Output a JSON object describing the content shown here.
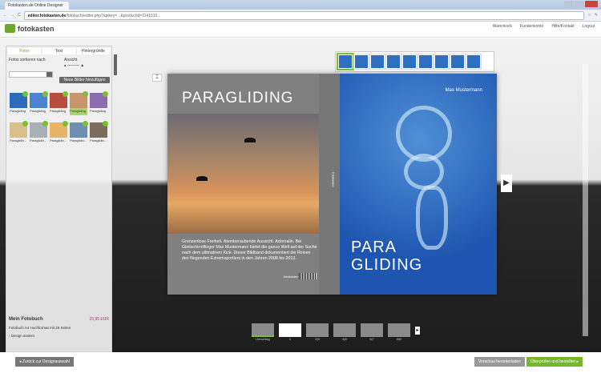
{
  "browser": {
    "tab_title": "Fotokasten.de Online Designer",
    "url_host": "editor.fotokasten.de",
    "url_rest": "/fotobuch/editor.php?apikey=...&productid=1141510...",
    "window_label": "Fotokasten"
  },
  "header": {
    "logo": "fotokasten",
    "links": [
      "Warenkorb",
      "Kundenkonto",
      "Hilfe/Kontakt",
      "Logout"
    ]
  },
  "left_panel": {
    "tabs": [
      "Fotos",
      "Text",
      "Hintergründe"
    ],
    "sort_label": "Fotos sortieren nach",
    "view_label": "Ansicht",
    "add_button": "Neue Bilder hinzufügen",
    "photos": [
      {
        "label": "Paragliding",
        "color": "#2f6bbd"
      },
      {
        "label": "Paragliding",
        "color": "#4a84cf"
      },
      {
        "label": "Paragliding",
        "color": "#b84b3c"
      },
      {
        "label": "Paragliding",
        "color": "#c9966c"
      },
      {
        "label": "Paragliding",
        "color": "#8a6eb0"
      },
      {
        "label": "Paraglidin...",
        "color": "#d9c08a"
      },
      {
        "label": "Paraglidin...",
        "color": "#a9b0b5"
      },
      {
        "label": "Paraglidin...",
        "color": "#e8b46a"
      },
      {
        "label": "Paraglidin...",
        "color": "#6f8fb0"
      },
      {
        "label": "Paraglidin...",
        "color": "#7d6c5c"
      }
    ],
    "summary": {
      "title": "Mein Fotobuch",
      "price": "29,95 EUR",
      "subtitle": "Fotobuch A4 Hochformat mit 26 Seiten",
      "link": "› Design ändern"
    }
  },
  "book": {
    "back_title": "PARAGLIDING",
    "back_text": "Grenzenlose Freiheit. Atemberaubende Aussicht. Adrenalin. Bei Gleitschirmflieger Max Mustermann bietet die ganze Welt auf der Suche nach dem ultimativen Kick. Dieser Bildband dokumentiert die Reisen des fliegenden Extremsportlers in den Jahren 2008 bis 2013.",
    "back_logo": "fotokasten",
    "spine_text": "fotokasten",
    "author": "Max Mustermann",
    "front_title_1": "PARA",
    "front_title_2": "GLIDING"
  },
  "page_strip": [
    "Umschlag",
    "1",
    "2|3",
    "4|5",
    "6|7",
    "8|9"
  ],
  "footer": {
    "back_button": "◂  Zurück zur Designauswahl",
    "preview_button": "Vorschau herunterladen",
    "order_button": "Überprüfen und bestellen  ▸"
  }
}
